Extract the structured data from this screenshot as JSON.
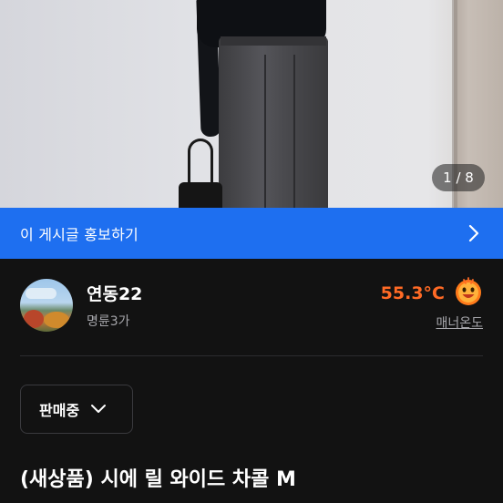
{
  "photo": {
    "pager": "1 / 8"
  },
  "promo": {
    "label": "이 게시글 홍보하기"
  },
  "seller": {
    "name": "연동22",
    "subinfo": "명륜3가",
    "temperature": "55.3°C",
    "manner_label": "매너온도",
    "temperature_color": "#ff6a25"
  },
  "status": {
    "selected": "판매중"
  },
  "product": {
    "title": "(새상품) 시에 릴 와이드 차콜 M"
  },
  "colors": {
    "accent_blue": "#1e6ff0",
    "background": "#121212"
  }
}
